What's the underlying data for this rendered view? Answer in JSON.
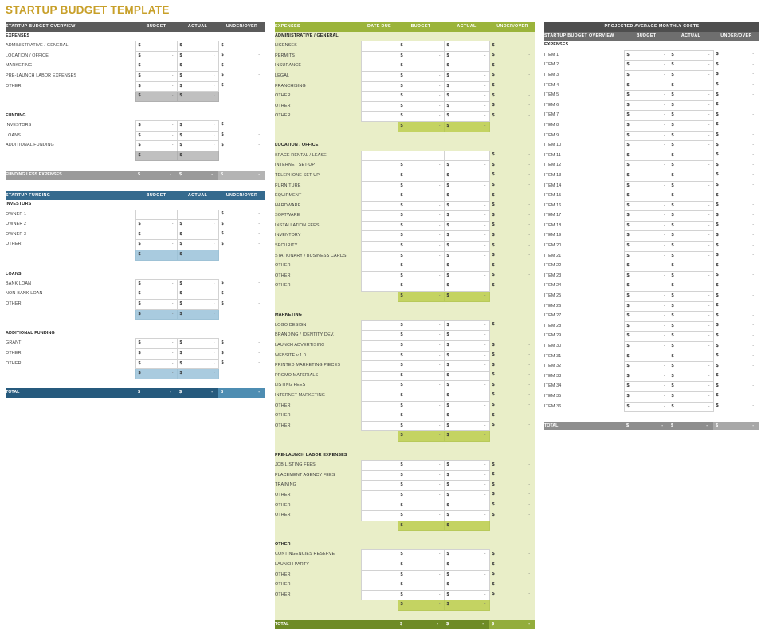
{
  "page": {
    "title": "STARTUP BUDGET TEMPLATE",
    "title_color": "#c8a02a"
  },
  "glyphs": {
    "currency": "$",
    "dash": "-"
  },
  "left": {
    "overview": {
      "header": {
        "label": "STARTUP BUDGET OVERVIEW",
        "budget": "BUDGET",
        "actual": "ACTUAL",
        "under_over": "UNDER/OVER",
        "color": "#5b5b5b"
      },
      "groups": [
        {
          "name": "EXPENSES",
          "rows": [
            "ADMINISTRATIVE / GENERAL",
            "LOCATION / OFFICE",
            "MARKETING",
            "PRE-LAUNCH LABOR EXPENSES",
            "OTHER"
          ]
        },
        {
          "name": "FUNDING",
          "rows": [
            "INVESTORS",
            "LOANS",
            "ADDITIONAL FUNDING"
          ]
        }
      ],
      "footer": {
        "label": "FUNDING LESS EXPENSES",
        "color": "#9a9a9a"
      }
    },
    "funding": {
      "header": {
        "label": "STARTUP FUNDING",
        "budget": "BUDGET",
        "actual": "ACTUAL",
        "under_over": "UNDER/OVER",
        "color": "#356a8e"
      },
      "groups": [
        {
          "name": "INVESTORS",
          "rows": [
            "OWNER 1",
            "OWNER 2",
            "OWNER 3",
            "OTHER"
          ]
        },
        {
          "name": "LOANS",
          "rows": [
            "BANK LOAN",
            "NON-BANK LOAN",
            "OTHER"
          ]
        },
        {
          "name": "ADDITIONAL FUNDING",
          "rows": [
            "GRANT",
            "OTHER",
            "OTHER"
          ]
        }
      ],
      "footer": {
        "label": "TOTAL",
        "color": "#265a7d"
      }
    }
  },
  "middle": {
    "header": {
      "label": "EXPENSES",
      "date_due": "DATE DUE",
      "budget": "BUDGET",
      "actual": "ACTUAL",
      "under_over": "UNDER/OVER",
      "color": "#9bb43b"
    },
    "groups": [
      {
        "name": "ADMINISTRATIVE / GENERAL",
        "rows": [
          "LICENSES",
          "PERMITS",
          "INSURANCE",
          "LEGAL",
          "FRANCHISING",
          "OTHER",
          "OTHER",
          "OTHER"
        ]
      },
      {
        "name": "LOCATION / OFFICE",
        "rows": [
          "SPACE RENTAL / LEASE",
          "INTERNET SET-UP",
          "TELEPHONE SET-UP",
          "FURNITURE",
          "EQUIPMENT",
          "HARDWARE",
          "SOFTWARE",
          "INSTALLATION FEES",
          "INVENTORY",
          "SECURITY",
          "STATIONARY / BUSINESS CARDS",
          "OTHER",
          "OTHER",
          "OTHER"
        ]
      },
      {
        "name": "MARKETING",
        "rows": [
          "LOGO DESIGN",
          "BRANDING / IDENTITY DEV.",
          "LAUNCH ADVERTISING",
          "WEBSITE v.1.0",
          "PRINTED MARKETING PIECES",
          "PROMO MATERIALS",
          "LISTING FEES",
          "INTERNET MARKETING",
          "OTHER",
          "OTHER",
          "OTHER"
        ]
      },
      {
        "name": "PRE-LAUNCH LABOR EXPENSES",
        "rows": [
          "JOB LISTING FEES",
          "PLACEMENT AGENCY FEES",
          "TRAINING",
          "OTHER",
          "OTHER",
          "OTHER"
        ]
      },
      {
        "name": "OTHER",
        "rows": [
          "CONTINGENCIES RESERVE",
          "LAUNCH PARTY",
          "OTHER",
          "OTHER",
          "OTHER"
        ]
      }
    ],
    "footer": {
      "label": "TOTAL",
      "color": "#6e8b26"
    }
  },
  "right": {
    "caption": "PROJECTED AVERAGE MONTHLY COSTS",
    "header": {
      "label": "STARTUP BUDGET OVERVIEW",
      "budget": "BUDGET",
      "actual": "ACTUAL",
      "under_over": "UNDER/OVER",
      "color": "#6e6e6e"
    },
    "group_name": "EXPENSES",
    "rows": [
      "ITEM 1",
      "ITEM 2",
      "ITEM 3",
      "ITEM 4",
      "ITEM 5",
      "ITEM 6",
      "ITEM 7",
      "ITEM 8",
      "ITEM 9",
      "ITEM 10",
      "ITEM 11",
      "ITEM 12",
      "ITEM 13",
      "ITEM 14",
      "ITEM 15",
      "ITEM 16",
      "ITEM 17",
      "ITEM 18",
      "ITEM 19",
      "ITEM 20",
      "ITEM 21",
      "ITEM 22",
      "ITEM 23",
      "ITEM 24",
      "ITEM 25",
      "ITEM 26",
      "ITEM 27",
      "ITEM 28",
      "ITEM 29",
      "ITEM 30",
      "ITEM 31",
      "ITEM 32",
      "ITEM 33",
      "ITEM 34",
      "ITEM 35",
      "ITEM 36"
    ],
    "footer": {
      "label": "TOTAL",
      "color": "#8e8e8e"
    }
  }
}
